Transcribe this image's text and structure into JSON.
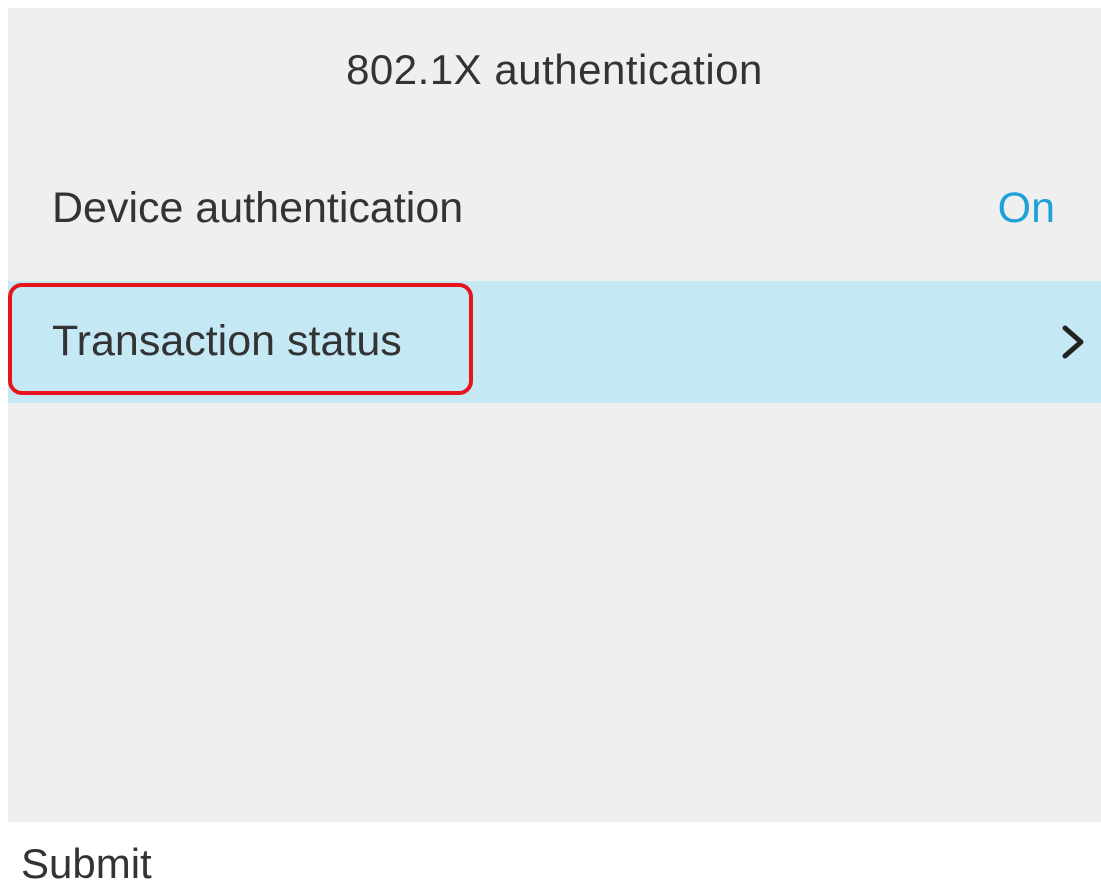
{
  "screen": {
    "title": "802.1X authentication"
  },
  "settings": [
    {
      "label": "Device authentication",
      "value": "On"
    },
    {
      "label": "Transaction status",
      "value": null,
      "icon": "chevron-right-icon",
      "selected": true
    }
  ],
  "softkeys": {
    "submit_label": "Submit"
  },
  "colors": {
    "screen_background": "#efefef",
    "selected_row": "#c5e8f5",
    "value_text": "#1ea1d9",
    "highlight_outline": "#e8131c"
  }
}
